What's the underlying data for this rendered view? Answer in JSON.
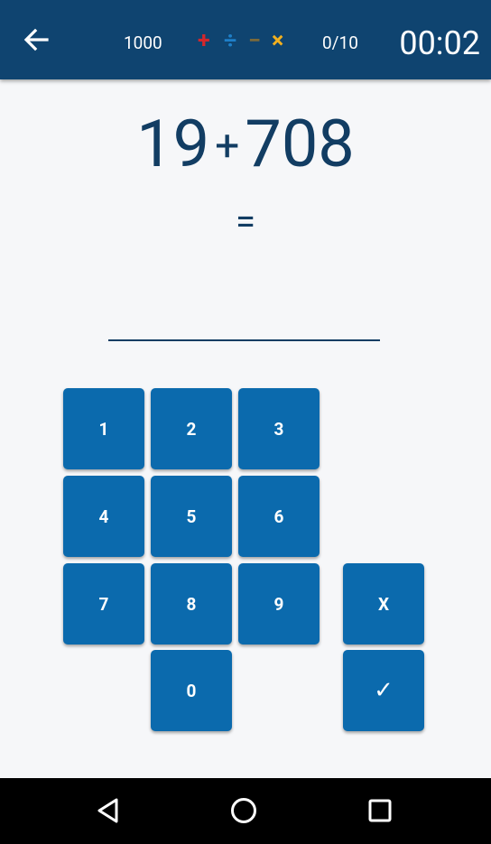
{
  "header": {
    "back_icon": "arrow-left-icon",
    "score": "1000",
    "operations": [
      {
        "name": "plus",
        "symbol": "+",
        "color": "#d3272c"
      },
      {
        "name": "divide",
        "symbol": "÷",
        "color": "#1e7fc8"
      },
      {
        "name": "minus",
        "symbol": "−",
        "color": "#7b6a3a"
      },
      {
        "name": "multiply",
        "symbol": "×",
        "color": "#f2b01e"
      }
    ],
    "progress": "0/10",
    "timer": "00:02",
    "background_color": "#0f4470"
  },
  "problem": {
    "operand_a": "19",
    "operator": "+",
    "operand_b": "708",
    "equals": "=",
    "answer": "",
    "text_color": "#123d63"
  },
  "keypad": {
    "key_color": "#0b6aad",
    "keys": [
      "1",
      "2",
      "3",
      "4",
      "5",
      "6",
      "7",
      "8",
      "9",
      "0"
    ],
    "clear_label": "X",
    "submit_label": "✓"
  },
  "system_nav": {
    "back_icon": "triangle-back-icon",
    "home_icon": "circle-home-icon",
    "recents_icon": "square-recents-icon"
  }
}
